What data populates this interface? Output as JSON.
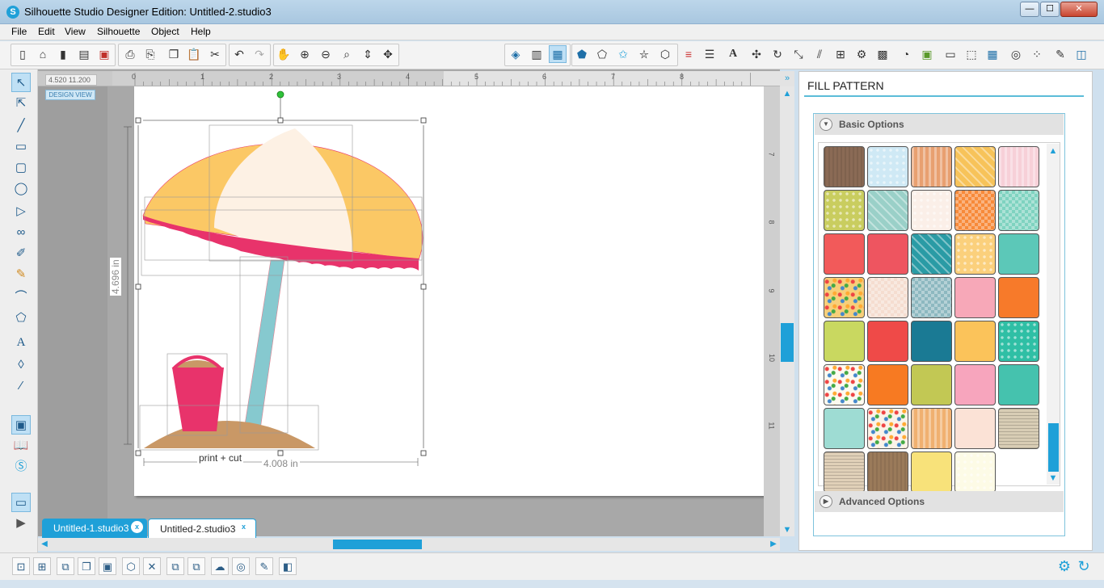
{
  "window": {
    "title": "Silhouette Studio Designer Edition: Untitled-2.studio3",
    "logo_letter": "S",
    "minimize": "—",
    "maximize": "☐",
    "close": "✕"
  },
  "menu": [
    "File",
    "Edit",
    "View",
    "Silhouette",
    "Object",
    "Help"
  ],
  "toolbar": {
    "left_icons": [
      "new-doc-icon",
      "open-icon",
      "open-library-icon",
      "save-icon",
      "save-sd-icon",
      "print-icon",
      "print-cut-icon",
      "copy-icon",
      "paste-icon",
      "cut-icon",
      "undo-icon",
      "redo-icon",
      "pan-icon",
      "zoom-in-icon",
      "zoom-out-icon",
      "zoom-select-icon",
      "zoom-fit-icon",
      "fit-page-icon"
    ],
    "right_icons": [
      "fill-color-icon",
      "fill-gradient-icon",
      "fill-pattern-icon",
      "shadow-icon",
      "line-color-icon",
      "line-style-icon",
      "text-icon",
      "transform-icon",
      "rotate-icon",
      "scale-icon",
      "shear-icon",
      "align-icon",
      "replicate-icon",
      "modify-icon",
      "offset-icon",
      "trace-icon",
      "page-setup-icon",
      "cut-settings-icon",
      "send-icon",
      "grid-icon",
      "registration-icon",
      "knife-icon",
      "eraser-icon",
      "settings-icon"
    ]
  },
  "coords": "4.520  11.200",
  "design_view": "DESIGN VIEW",
  "ruler": {
    "top_ticks": [
      "0",
      "1",
      "2",
      "3",
      "4",
      "5",
      "6",
      "7",
      "8"
    ],
    "right_ticks": [
      "7",
      "8",
      "9",
      "10",
      "11"
    ]
  },
  "canvas": {
    "print_cut_label": "print + cut",
    "width_label": "4.008 in",
    "height_label": "4.696 in"
  },
  "tabs": [
    {
      "label": "Untitled-1.studio3",
      "close": "x",
      "active": true
    },
    {
      "label": "Untitled-2.studio3",
      "close": "x",
      "active": false
    }
  ],
  "panel": {
    "title": "FILL PATTERN",
    "basic_options": "Basic Options",
    "advanced_options": "Advanced Options",
    "swatches": [
      [
        "#8a6a55",
        "#cfe9f5",
        "#e8a070",
        "#f7c35a",
        "#f7d0d8"
      ],
      [
        "#c9cd5f",
        "#9ad0c8",
        "#fbefe8",
        "#f78a3a",
        "#7fd3c0"
      ],
      [
        "#f25a5a",
        "#ee5560",
        "#2a9ba5",
        "#fbd07c",
        "#5cc8b8"
      ],
      [
        "#f7cf7a",
        "#f5ddd0",
        "#8db8c0",
        "#f7a8b8",
        "#f77a2a"
      ],
      [
        "#c9d860",
        "#ef4a48",
        "#1a7a94",
        "#fbc35a",
        "#2fbfa5"
      ],
      [
        "#fdfaf0",
        "#f77a22",
        "#c2c854",
        "#f7a5bd",
        "#45c2ae"
      ],
      [
        "#9edcd3",
        "#fbf3e8",
        "#f0b070",
        "#fbe2d6",
        "#d8cdb5"
      ],
      [
        "#e0d0b8",
        "#9a7a5a",
        "#f8e27a",
        "#fdfbe6"
      ]
    ],
    "patterns": [
      [
        "wood",
        "dots",
        "stripes",
        "diag",
        "stripes"
      ],
      [
        "dots",
        "diag",
        "dots",
        "check",
        "check"
      ],
      [
        "plain",
        "plain",
        "diag",
        "dots",
        "plain"
      ],
      [
        "confetti",
        "check",
        "check",
        "plain",
        "plain"
      ],
      [
        "plain",
        "plain",
        "plain",
        "plain",
        "dots"
      ],
      [
        "confetti",
        "plain",
        "plain",
        "plain",
        "plain"
      ],
      [
        "plain",
        "confetti",
        "stripes",
        "plain",
        "news"
      ],
      [
        "news",
        "wood",
        "plain",
        "dots"
      ]
    ]
  },
  "bottom_icons": [
    "group-icon",
    "ungroup-icon",
    "compound-icon",
    "release-icon",
    "bring-front-icon",
    "send-back-icon",
    "weld-icon",
    "delete-icon",
    "bring-forward-icon",
    "send-backward-icon",
    "shapes-icon",
    "offset-icon",
    "trace-icon",
    "knife-icon"
  ],
  "colors": {
    "accent": "#1fa0d8",
    "umbrella_yellow": "#fbc865",
    "umbrella_cream": "#fdf1e4",
    "umbrella_pink": "#e8336b",
    "pole": "#86c9cf",
    "sand": "#c99866",
    "bucket": "#e8336b"
  }
}
